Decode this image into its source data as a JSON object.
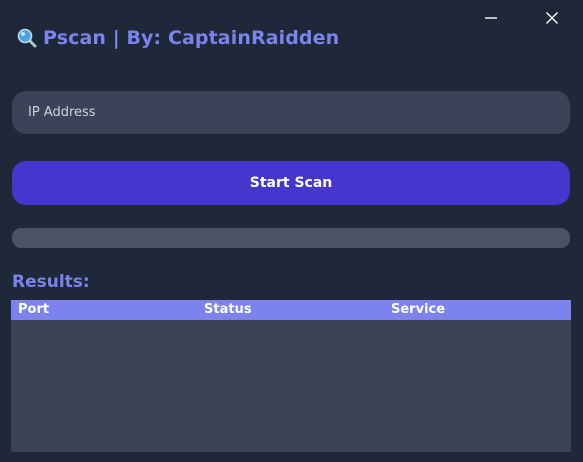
{
  "window": {
    "title": "Pscan | By: CaptainRaidden",
    "title_icon": "magnifier-icon",
    "controls": [
      "minimize-icon",
      "close-icon"
    ]
  },
  "form": {
    "ip_placeholder": "IP Address",
    "ip_value": "",
    "start_label": "Start Scan"
  },
  "progress": {
    "value": 0
  },
  "results": {
    "label": "Results:",
    "columns": [
      "Port",
      "Status",
      "Service"
    ],
    "rows": []
  },
  "colors": {
    "background": "#1f2838",
    "accent": "#7b83ee",
    "button": "#4536ce",
    "input": "#3a4357",
    "table_body": "#3a4353"
  }
}
